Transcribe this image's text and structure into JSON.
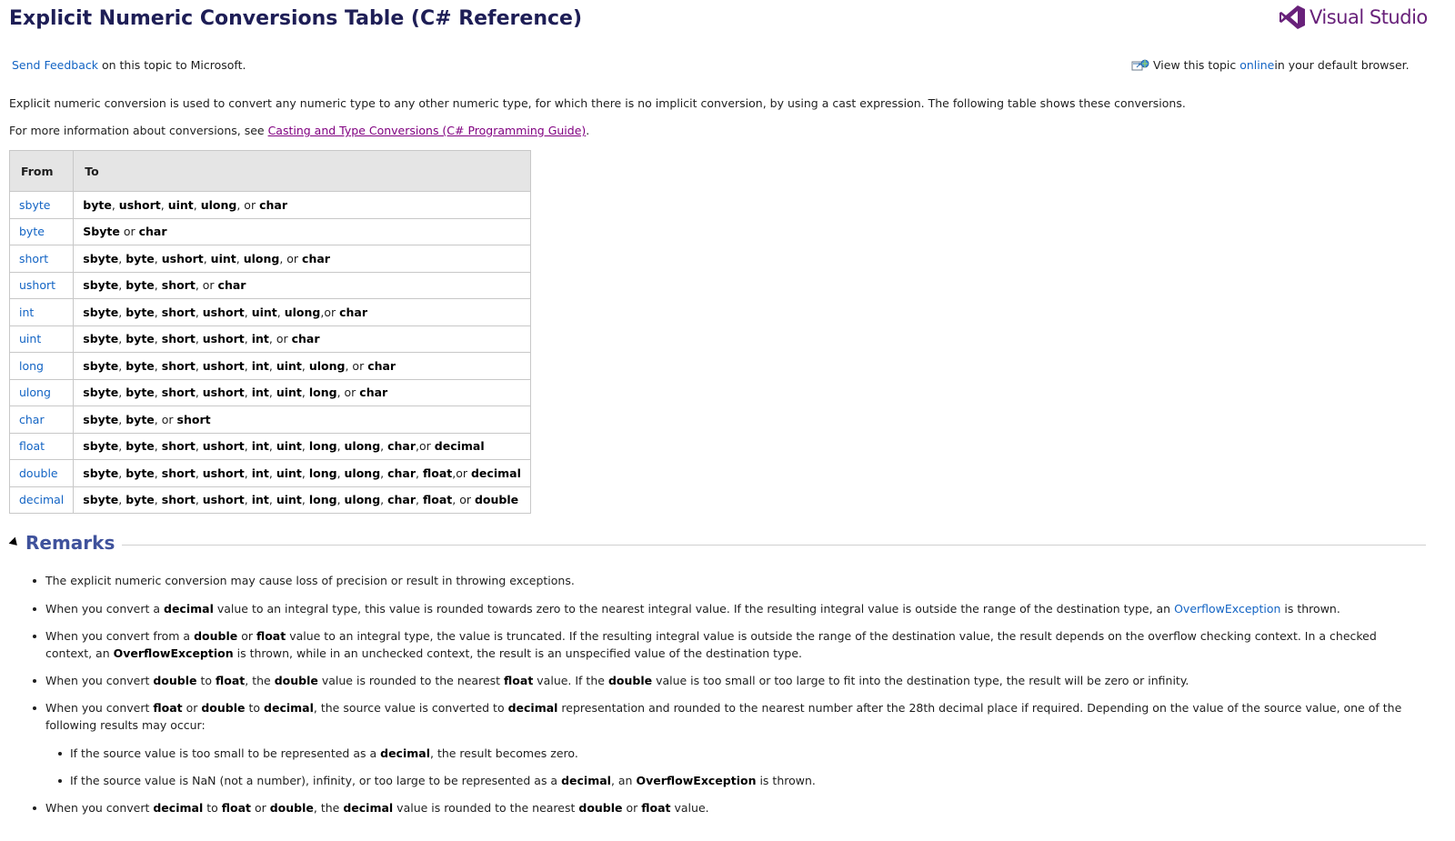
{
  "title": "Explicit Numeric Conversions Table (C# Reference)",
  "logo": {
    "text": "Visual Studio",
    "color": "#68217a"
  },
  "feedback": {
    "link": "Send Feedback",
    "rest": " on this topic to Microsoft."
  },
  "online": {
    "pre": "View this topic ",
    "link": "online",
    "post": " in your default browser."
  },
  "intro": "Explicit numeric conversion is used to convert any numeric type to any other numeric type, for which there is no implicit conversion, by using a cast expression. The following table shows these conversions.",
  "more_info": {
    "pre": "For more information about conversions, see ",
    "link": "Casting and Type Conversions (C# Programming Guide)",
    "post": "."
  },
  "table": {
    "headers": [
      "From",
      "To"
    ],
    "rows": [
      {
        "from": "sbyte",
        "to": [
          [
            "byte",
            true
          ],
          [
            ", ",
            false
          ],
          [
            "ushort",
            true
          ],
          [
            ", ",
            false
          ],
          [
            "uint",
            true
          ],
          [
            ", ",
            false
          ],
          [
            "ulong",
            true
          ],
          [
            ", or ",
            false
          ],
          [
            "char",
            true
          ]
        ]
      },
      {
        "from": "byte",
        "to": [
          [
            "Sbyte",
            true
          ],
          [
            " or ",
            false
          ],
          [
            "char",
            true
          ]
        ]
      },
      {
        "from": "short",
        "to": [
          [
            "sbyte",
            true
          ],
          [
            ", ",
            false
          ],
          [
            "byte",
            true
          ],
          [
            ", ",
            false
          ],
          [
            "ushort",
            true
          ],
          [
            ", ",
            false
          ],
          [
            "uint",
            true
          ],
          [
            ", ",
            false
          ],
          [
            "ulong",
            true
          ],
          [
            ", or ",
            false
          ],
          [
            "char",
            true
          ]
        ]
      },
      {
        "from": "ushort",
        "to": [
          [
            "sbyte",
            true
          ],
          [
            ", ",
            false
          ],
          [
            "byte",
            true
          ],
          [
            ", ",
            false
          ],
          [
            "short",
            true
          ],
          [
            ", or ",
            false
          ],
          [
            "char",
            true
          ]
        ]
      },
      {
        "from": "int",
        "to": [
          [
            "sbyte",
            true
          ],
          [
            ", ",
            false
          ],
          [
            "byte",
            true
          ],
          [
            ", ",
            false
          ],
          [
            "short",
            true
          ],
          [
            ", ",
            false
          ],
          [
            "ushort",
            true
          ],
          [
            ", ",
            false
          ],
          [
            "uint",
            true
          ],
          [
            ", ",
            false
          ],
          [
            "ulong",
            true
          ],
          [
            ",or ",
            false
          ],
          [
            "char",
            true
          ]
        ]
      },
      {
        "from": "uint",
        "to": [
          [
            "sbyte",
            true
          ],
          [
            ", ",
            false
          ],
          [
            "byte",
            true
          ],
          [
            ", ",
            false
          ],
          [
            "short",
            true
          ],
          [
            ", ",
            false
          ],
          [
            "ushort",
            true
          ],
          [
            ", ",
            false
          ],
          [
            "int",
            true
          ],
          [
            ", or ",
            false
          ],
          [
            "char",
            true
          ]
        ]
      },
      {
        "from": "long",
        "to": [
          [
            "sbyte",
            true
          ],
          [
            ", ",
            false
          ],
          [
            "byte",
            true
          ],
          [
            ", ",
            false
          ],
          [
            "short",
            true
          ],
          [
            ", ",
            false
          ],
          [
            "ushort",
            true
          ],
          [
            ", ",
            false
          ],
          [
            "int",
            true
          ],
          [
            ", ",
            false
          ],
          [
            "uint",
            true
          ],
          [
            ", ",
            false
          ],
          [
            "ulong",
            true
          ],
          [
            ", or ",
            false
          ],
          [
            "char",
            true
          ]
        ]
      },
      {
        "from": "ulong",
        "to": [
          [
            "sbyte",
            true
          ],
          [
            ", ",
            false
          ],
          [
            "byte",
            true
          ],
          [
            ", ",
            false
          ],
          [
            "short",
            true
          ],
          [
            ", ",
            false
          ],
          [
            "ushort",
            true
          ],
          [
            ", ",
            false
          ],
          [
            "int",
            true
          ],
          [
            ", ",
            false
          ],
          [
            "uint",
            true
          ],
          [
            ", ",
            false
          ],
          [
            "long",
            true
          ],
          [
            ", or ",
            false
          ],
          [
            "char",
            true
          ]
        ]
      },
      {
        "from": "char",
        "to": [
          [
            "sbyte",
            true
          ],
          [
            ", ",
            false
          ],
          [
            "byte",
            true
          ],
          [
            ", or ",
            false
          ],
          [
            "short",
            true
          ]
        ]
      },
      {
        "from": "float",
        "to": [
          [
            "sbyte",
            true
          ],
          [
            ", ",
            false
          ],
          [
            "byte",
            true
          ],
          [
            ", ",
            false
          ],
          [
            "short",
            true
          ],
          [
            ", ",
            false
          ],
          [
            "ushort",
            true
          ],
          [
            ", ",
            false
          ],
          [
            "int",
            true
          ],
          [
            ", ",
            false
          ],
          [
            "uint",
            true
          ],
          [
            ", ",
            false
          ],
          [
            "long",
            true
          ],
          [
            ", ",
            false
          ],
          [
            "ulong",
            true
          ],
          [
            ", ",
            false
          ],
          [
            "char",
            true
          ],
          [
            ",or ",
            false
          ],
          [
            "decimal",
            true
          ]
        ]
      },
      {
        "from": "double",
        "to": [
          [
            "sbyte",
            true
          ],
          [
            ", ",
            false
          ],
          [
            "byte",
            true
          ],
          [
            ", ",
            false
          ],
          [
            "short",
            true
          ],
          [
            ", ",
            false
          ],
          [
            "ushort",
            true
          ],
          [
            ", ",
            false
          ],
          [
            "int",
            true
          ],
          [
            ", ",
            false
          ],
          [
            "uint",
            true
          ],
          [
            ", ",
            false
          ],
          [
            "long",
            true
          ],
          [
            ", ",
            false
          ],
          [
            "ulong",
            true
          ],
          [
            ", ",
            false
          ],
          [
            "char",
            true
          ],
          [
            ", ",
            false
          ],
          [
            "float",
            true
          ],
          [
            ",or ",
            false
          ],
          [
            "decimal",
            true
          ]
        ]
      },
      {
        "from": "decimal",
        "to": [
          [
            "sbyte",
            true
          ],
          [
            ", ",
            false
          ],
          [
            "byte",
            true
          ],
          [
            ", ",
            false
          ],
          [
            "short",
            true
          ],
          [
            ", ",
            false
          ],
          [
            "ushort",
            true
          ],
          [
            ", ",
            false
          ],
          [
            "int",
            true
          ],
          [
            ", ",
            false
          ],
          [
            "uint",
            true
          ],
          [
            ", ",
            false
          ],
          [
            "long",
            true
          ],
          [
            ", ",
            false
          ],
          [
            "ulong",
            true
          ],
          [
            ", ",
            false
          ],
          [
            "char",
            true
          ],
          [
            ", ",
            false
          ],
          [
            "float",
            true
          ],
          [
            ", or ",
            false
          ],
          [
            "double",
            true
          ]
        ]
      }
    ]
  },
  "remarks": {
    "heading": "Remarks",
    "bullets": [
      {
        "level": 1,
        "parts": [
          [
            "The explicit numeric conversion may cause loss of precision or result in throwing exceptions.",
            "t"
          ]
        ]
      },
      {
        "level": 1,
        "parts": [
          [
            "When you convert a ",
            "t"
          ],
          [
            "decimal",
            "b"
          ],
          [
            " value to an integral type, this value is rounded towards zero to the nearest integral value. If the resulting integral value is outside the range of the destination type, an ",
            "t"
          ],
          [
            "OverflowException",
            "l"
          ],
          [
            " is thrown.",
            "t"
          ]
        ]
      },
      {
        "level": 1,
        "parts": [
          [
            "When you convert from a ",
            "t"
          ],
          [
            "double",
            "b"
          ],
          [
            " or ",
            "t"
          ],
          [
            "float",
            "b"
          ],
          [
            " value to an integral type, the value is truncated. If the resulting integral value is outside the range of the destination value, the result depends on the overflow checking context. In a checked context, an ",
            "t"
          ],
          [
            "OverflowException",
            "b"
          ],
          [
            " is thrown, while in an unchecked context, the result is an unspecified value of the destination type.",
            "t"
          ]
        ]
      },
      {
        "level": 1,
        "parts": [
          [
            "When you convert ",
            "t"
          ],
          [
            "double",
            "b"
          ],
          [
            " to ",
            "t"
          ],
          [
            "float",
            "b"
          ],
          [
            ", the ",
            "t"
          ],
          [
            "double",
            "b"
          ],
          [
            " value is rounded to the nearest ",
            "t"
          ],
          [
            "float",
            "b"
          ],
          [
            " value. If the ",
            "t"
          ],
          [
            "double",
            "b"
          ],
          [
            " value is too small or too large to fit into the destination type, the result will be zero or infinity.",
            "t"
          ]
        ]
      },
      {
        "level": 1,
        "parts": [
          [
            "When you convert ",
            "t"
          ],
          [
            "float",
            "b"
          ],
          [
            " or ",
            "t"
          ],
          [
            "double",
            "b"
          ],
          [
            " to ",
            "t"
          ],
          [
            "decimal",
            "b"
          ],
          [
            ", the source value is converted to ",
            "t"
          ],
          [
            "decimal",
            "b"
          ],
          [
            " representation and rounded to the nearest number after the 28th decimal place if required. Depending on the value of the source value, one of the following results may occur:",
            "t"
          ]
        ]
      },
      {
        "level": 2,
        "parts": [
          [
            "If the source value is too small to be represented as a ",
            "t"
          ],
          [
            "decimal",
            "b"
          ],
          [
            ", the result becomes zero.",
            "t"
          ]
        ]
      },
      {
        "level": 2,
        "parts": [
          [
            "If the source value is NaN (not a number), infinity, or too large to be represented as a ",
            "t"
          ],
          [
            "decimal",
            "b"
          ],
          [
            ", an ",
            "t"
          ],
          [
            "OverflowException",
            "b"
          ],
          [
            " is thrown.",
            "t"
          ]
        ]
      },
      {
        "level": 1,
        "parts": [
          [
            "When you convert ",
            "t"
          ],
          [
            "decimal",
            "b"
          ],
          [
            " to ",
            "t"
          ],
          [
            "float",
            "b"
          ],
          [
            " or ",
            "t"
          ],
          [
            "double",
            "b"
          ],
          [
            ", the ",
            "t"
          ],
          [
            "decimal",
            "b"
          ],
          [
            " value is rounded to the nearest ",
            "t"
          ],
          [
            "double",
            "b"
          ],
          [
            " or ",
            "t"
          ],
          [
            "float",
            "b"
          ],
          [
            " value.",
            "t"
          ]
        ]
      }
    ]
  }
}
